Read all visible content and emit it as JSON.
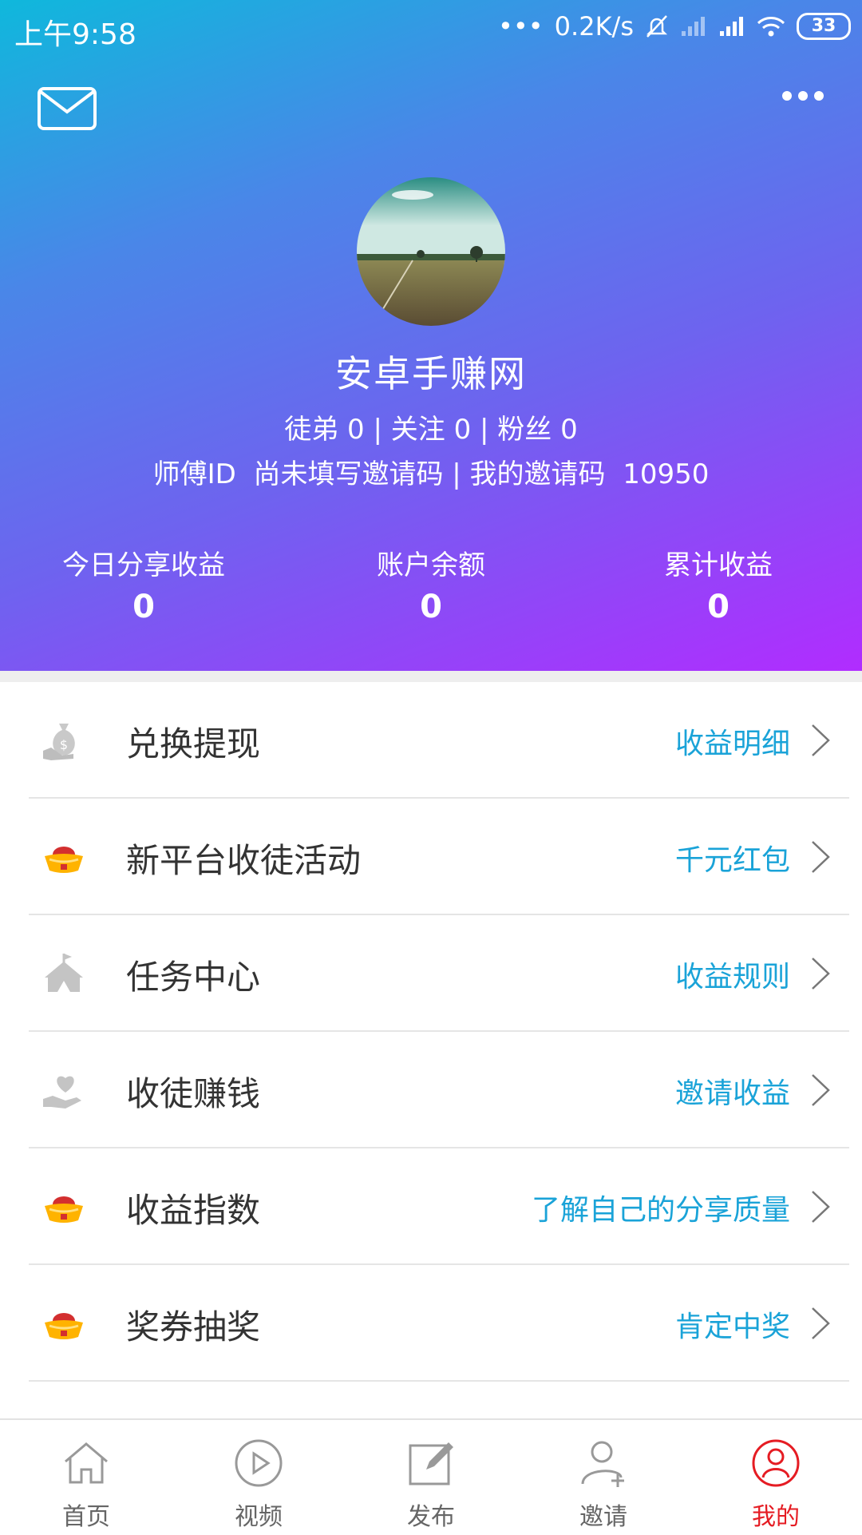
{
  "status_bar": {
    "time": "上午9:58",
    "network_speed": "0.2K/s",
    "battery": "33"
  },
  "profile": {
    "username": "安卓手赚网",
    "apprentice_label": "徒弟",
    "apprentice_count": "0",
    "following_label": "关注",
    "following_count": "0",
    "fans_label": "粉丝",
    "fans_count": "0",
    "master_id_label": "师傅ID",
    "master_id_value": "尚未填写邀请码",
    "invite_code_label": "我的邀请码",
    "invite_code_value": "10950"
  },
  "stats": [
    {
      "label": "今日分享收益",
      "value": "0"
    },
    {
      "label": "账户余额",
      "value": "0"
    },
    {
      "label": "累计收益",
      "value": "0"
    }
  ],
  "menu": [
    {
      "label": "兑换提现",
      "link": "收益明细",
      "icon": "money-bag-icon"
    },
    {
      "label": "新平台收徒活动",
      "link": "千元红包",
      "icon": "gold-ingot-icon"
    },
    {
      "label": "任务中心",
      "link": "收益规则",
      "icon": "tent-icon"
    },
    {
      "label": "收徒赚钱",
      "link": "邀请收益",
      "icon": "heart-hand-icon"
    },
    {
      "label": "收益指数",
      "link": "了解自己的分享质量",
      "icon": "gold-ingot-icon"
    },
    {
      "label": "奖券抽奖",
      "link": "肯定中奖",
      "icon": "gold-ingot-icon"
    }
  ],
  "tabs": [
    {
      "label": "首页",
      "icon": "home-icon"
    },
    {
      "label": "视频",
      "icon": "play-icon"
    },
    {
      "label": "发布",
      "icon": "edit-icon"
    },
    {
      "label": "邀请",
      "icon": "add-user-icon"
    },
    {
      "label": "我的",
      "icon": "profile-icon"
    }
  ],
  "colors": {
    "link": "#1aa3d8",
    "active_tab": "#e51c23",
    "gradient_start": "#0fb8dc",
    "gradient_end": "#b12cff"
  }
}
